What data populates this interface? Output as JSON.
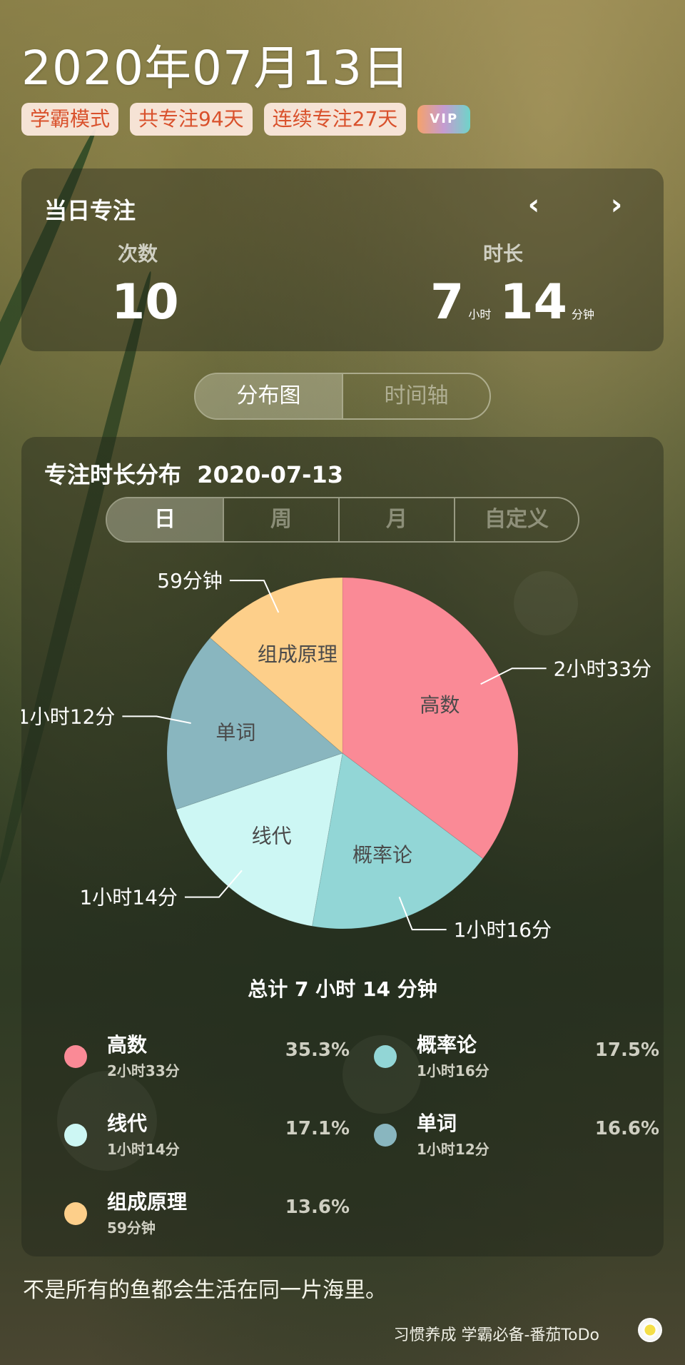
{
  "header": {
    "date": "2020年07月13日",
    "tags": [
      "学霸模式",
      "共专注94天",
      "连续专注27天"
    ],
    "vip_label": "VIP"
  },
  "daily_focus": {
    "title": "当日专注",
    "prev_icon": "chevron-left-icon",
    "next_icon": "chevron-right-icon",
    "prev_glyph": "‹",
    "next_glyph": "›",
    "count_label": "次数",
    "count_value": "10",
    "duration_label": "时长",
    "hours_value": "7",
    "hours_unit": "小时",
    "minutes_value": "14",
    "minutes_unit": "分钟"
  },
  "view_tabs": {
    "distribution": "分布图",
    "timeline": "时间轴",
    "active": "distribution"
  },
  "distribution": {
    "title": "专注时长分布",
    "date": "2020-07-13",
    "range_tabs": [
      "日",
      "周",
      "月",
      "自定义"
    ],
    "active_range": "日",
    "total_text": "总计 7 小时 14 分钟"
  },
  "chart_data": {
    "type": "pie",
    "unit": "minutes",
    "slices": [
      {
        "name": "高数",
        "minutes": 153,
        "time_label": "2小时33分",
        "legend_time": "2小时33分",
        "percent": "35.3%",
        "color": "#fa8a96"
      },
      {
        "name": "概率论",
        "minutes": 76,
        "time_label": "1小时16分",
        "legend_time": "1小时16分",
        "percent": "17.5%",
        "color": "#92d6d6"
      },
      {
        "name": "线代",
        "minutes": 74,
        "time_label": "1小时14分",
        "legend_time": "1小时14分",
        "percent": "17.1%",
        "color": "#cdf7f4"
      },
      {
        "name": "单词",
        "minutes": 72,
        "time_label": "1小时12分",
        "legend_time": "1小时12分",
        "percent": "16.6%",
        "color": "#89b6bf"
      },
      {
        "name": "组成原理",
        "minutes": 59,
        "time_label": "59分钟",
        "legend_time": "59分钟",
        "percent": "13.6%",
        "color": "#fdcf8a"
      }
    ]
  },
  "footer": {
    "quote": "不是所有的鱼都会生活在同一片海里。",
    "slogan": "习惯养成 学霸必备-番茄ToDo"
  }
}
